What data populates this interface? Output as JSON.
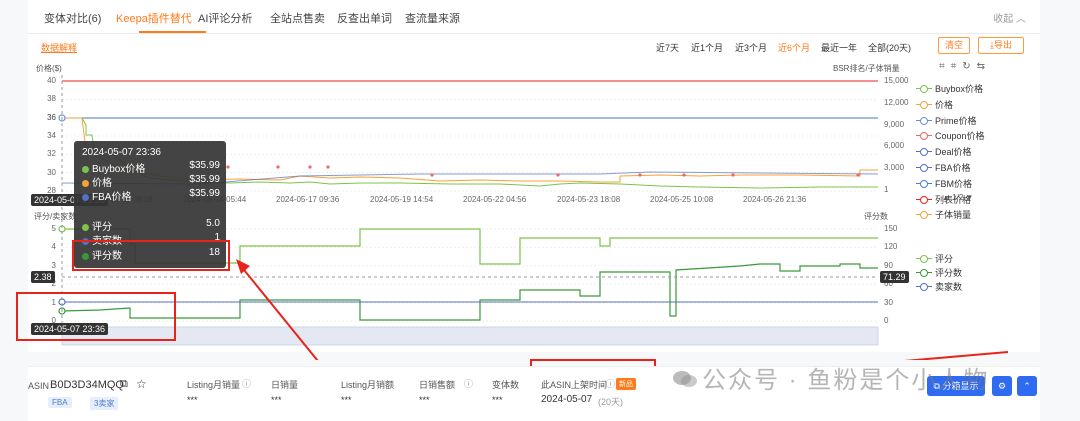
{
  "tabs": [
    {
      "label": "变体对比(6)"
    },
    {
      "label": "Keepa插件替代"
    },
    {
      "label": "AI评论分析"
    },
    {
      "label": "全站点售卖"
    },
    {
      "label": "反查出单词"
    },
    {
      "label": "查流量来源"
    }
  ],
  "collapse_label": "收起",
  "data_explain": "数据解释",
  "ranges": [
    "近7天",
    "近1个月",
    "近3个月",
    "近6个月",
    "最近一年",
    "全部(20天)"
  ],
  "active_range": "近6个月",
  "clear_label": "清空",
  "export_label": "导出",
  "top_chart": {
    "left_axis_label": "价格($)",
    "right_axis_label": "BSR排名/子体销量",
    "left_ticks": [
      "40",
      "38",
      "36",
      "34",
      "32",
      "30",
      "28"
    ],
    "right_ticks": [
      "15,000",
      "12,000",
      "9,000",
      "6,000",
      "3,000",
      "1"
    ],
    "x_ticks": [
      "2024-05-11 08:16",
      "2024-05-14 05:44",
      "2024-05-17 09:36",
      "2024-05-19 14:54",
      "2024-05-22 04:56",
      "2024-05-23 18:08",
      "2024-05-25 10:08",
      "2024-05-26 21:36"
    ],
    "left_cursor_value": "36",
    "x_cursor_tag": "2024-05-07 23:36"
  },
  "bottom_chart": {
    "left_axis_label": "评分/卖家数",
    "right_axis_label": "评分数",
    "left_ticks": [
      "5",
      "4",
      "3",
      "2",
      "1",
      "0"
    ],
    "right_ticks": [
      "150",
      "120",
      "90",
      "60",
      "30",
      "0"
    ],
    "left_cursor_value": "2.38",
    "right_cursor_value": "71.29",
    "x_cursor_tag": "2024-05-07 23:36"
  },
  "legend_top": [
    {
      "label": "Buybox价格",
      "color": "#7cc349"
    },
    {
      "label": "价格",
      "color": "#f7a234"
    },
    {
      "label": "Prime价格",
      "color": "#6b8fd6"
    },
    {
      "label": "Coupon价格",
      "color": "#ee6666"
    },
    {
      "label": "Deal价格",
      "color": "#5470c6"
    },
    {
      "label": "FBA价格",
      "color": "#5470c6"
    },
    {
      "label": "FBM价格",
      "color": "#4a7bd1"
    },
    {
      "label": "列表价格",
      "color": "#e8231a"
    },
    {
      "label": "子体销量",
      "color": "#f7a234"
    }
  ],
  "legend_pager": "▲ 1/2 ▼",
  "legend_bottom": [
    {
      "label": "评分",
      "color": "#7cc349"
    },
    {
      "label": "评分数",
      "color": "#3a9a3a"
    },
    {
      "label": "卖家数",
      "color": "#5470c6"
    }
  ],
  "tooltip": {
    "time": "2024-05-07 23:36",
    "rows": [
      {
        "label": "Buybox价格",
        "value": "$35.99",
        "color": "#7cc349"
      },
      {
        "label": "价格",
        "value": "$35.99",
        "color": "#f7a234"
      },
      {
        "label": "FBA价格",
        "value": "$35.99",
        "color": "#5470c6"
      },
      {
        "label": "评分",
        "value": "5.0",
        "color": "#7cc349"
      },
      {
        "label": "卖家数",
        "value": "1",
        "color": "#5470c6"
      },
      {
        "label": "评分数",
        "value": "18",
        "color": "#3a9a3a"
      }
    ]
  },
  "product": {
    "asin_label": "ASIN",
    "asin": "B0D3D34MQQ",
    "chips": [
      "FBA",
      "3卖家"
    ],
    "metrics": [
      {
        "label": "Listing月销量",
        "value": "***"
      },
      {
        "label": "日销量",
        "value": "***"
      },
      {
        "label": "Listing月销额",
        "value": "***"
      },
      {
        "label": "日销售额",
        "value": "***"
      },
      {
        "label": "变体数",
        "value": "***"
      }
    ],
    "listed_label": "此ASIN上架时间",
    "new_badge": "新品",
    "listed_date": "2024-05-07",
    "listed_days": "(20天)"
  },
  "split_display_label": "分箱显示",
  "watermark": "公众号 · 鱼粉是个小人物",
  "colors": {
    "accent": "#ff7a1a",
    "highlight": "#e8231a",
    "primary": "#2f6bf1"
  }
}
